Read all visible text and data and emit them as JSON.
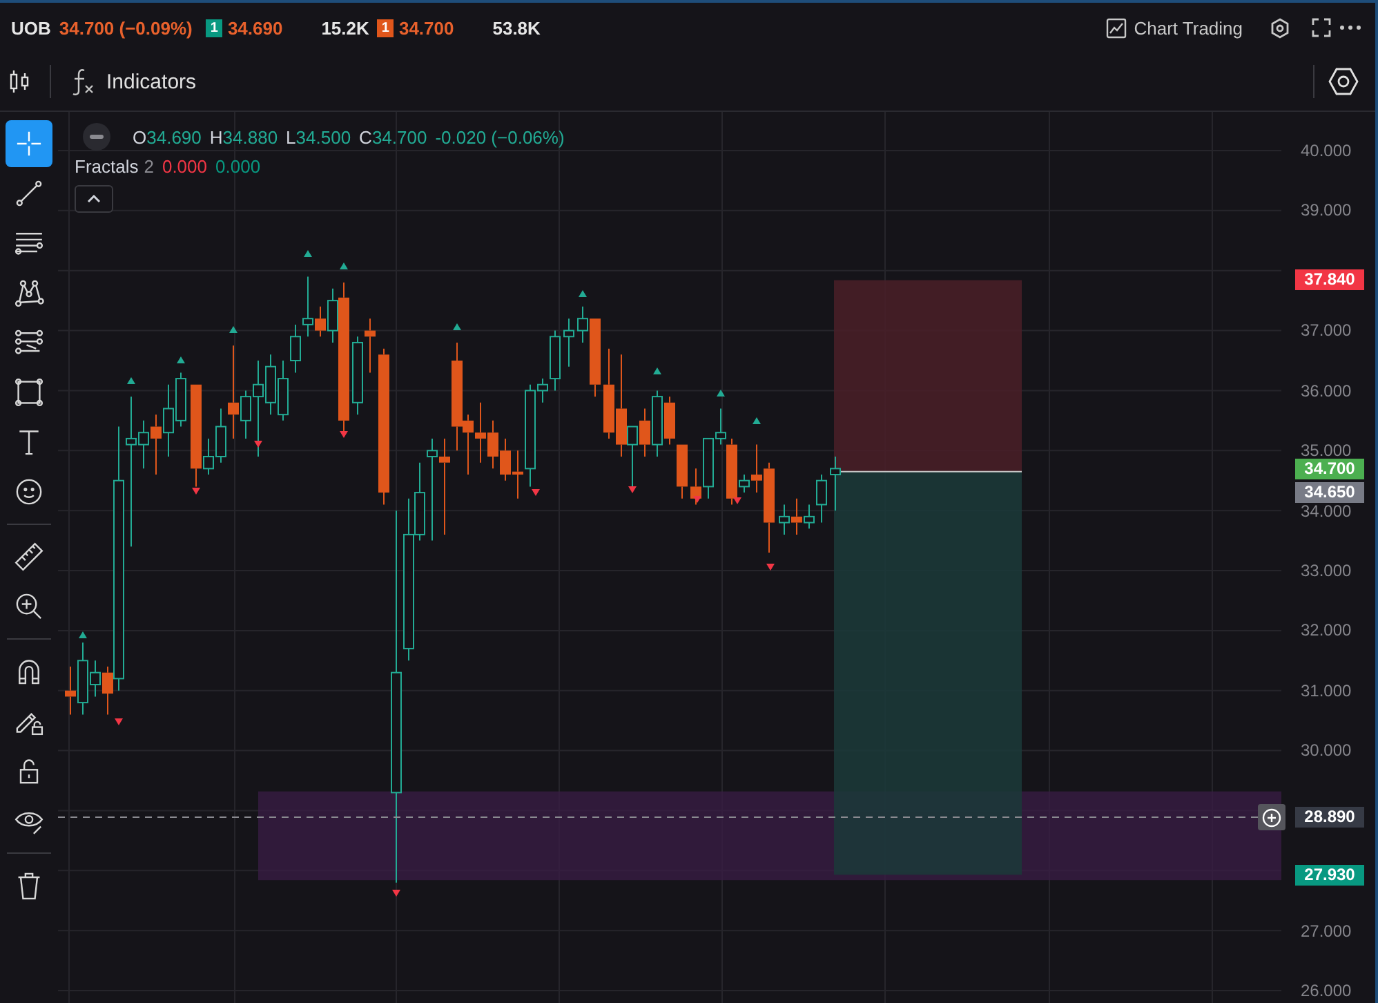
{
  "header": {
    "symbol": "UOB",
    "last": "34.700 (−0.09%)",
    "bid_badge": "1",
    "bid": "34.690",
    "bid_volume": "15.2K",
    "ask_badge": "1",
    "ask": "34.700",
    "ask_volume": "53.8K",
    "chart_trading": "Chart Trading"
  },
  "toolbar": {
    "indicators": "Indicators"
  },
  "tool_groups": [
    [
      {
        "kind": "crosshair",
        "selected": true
      },
      {
        "kind": "trendline",
        "selected": false
      },
      {
        "kind": "lines",
        "selected": false
      },
      {
        "kind": "pattern",
        "selected": false
      },
      {
        "kind": "fib",
        "selected": false
      },
      {
        "kind": "rectangle",
        "selected": false
      },
      {
        "kind": "text",
        "selected": false
      },
      {
        "kind": "emoji",
        "selected": false
      }
    ],
    [
      {
        "kind": "ruler",
        "selected": false
      },
      {
        "kind": "zoom",
        "selected": false
      }
    ],
    [
      {
        "kind": "magnet",
        "selected": false
      },
      {
        "kind": "lockdraw",
        "selected": false
      },
      {
        "kind": "lock",
        "selected": false
      },
      {
        "kind": "eye",
        "selected": false
      }
    ],
    [
      {
        "kind": "trash",
        "selected": false
      }
    ]
  ],
  "legend": {
    "ohlc": [
      {
        "label": "O",
        "value": "34.690"
      },
      {
        "label": "H",
        "value": "34.880"
      },
      {
        "label": "L",
        "value": "34.500"
      },
      {
        "label": "C",
        "value": "34.700"
      }
    ],
    "change": "-0.020 (−0.06%)"
  },
  "indicator": {
    "name": "Fractals",
    "param": "2",
    "values": [
      {
        "text": "0.000",
        "color": "#f23645"
      },
      {
        "text": "0.000",
        "color": "#089981"
      }
    ]
  },
  "price_axis": {
    "ticks": [
      "40.000",
      "39.000",
      "37.000",
      "36.000",
      "35.000",
      "34.000",
      "33.000",
      "32.000",
      "31.000",
      "30.000",
      "27.000",
      "26.000"
    ],
    "markers": [
      {
        "text": "37.840",
        "color": "#f23645",
        "plus": false
      },
      {
        "text": "34.700",
        "color": "#4caf50",
        "plus": false
      },
      {
        "text": "34.650",
        "color": "#787b86",
        "plus": false
      },
      {
        "text": "28.890",
        "color": "#363a45",
        "plus": true
      },
      {
        "text": "27.930",
        "color": "#089981",
        "plus": false
      }
    ]
  }
}
